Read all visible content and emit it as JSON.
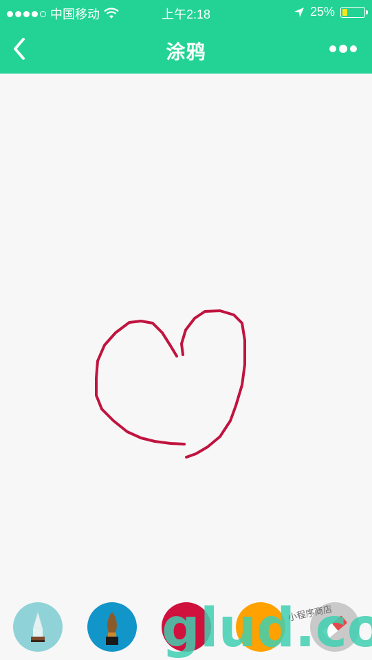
{
  "status_bar": {
    "carrier": "中国移动",
    "time": "上午2:18",
    "battery": "25%",
    "battery_level": 0.25
  },
  "nav": {
    "title": "涂鸦"
  },
  "toolbar": {
    "tools": [
      {
        "name": "pen",
        "color": "#8fd3d8"
      },
      {
        "name": "brush",
        "color": "#1295c9"
      },
      {
        "name": "color-red",
        "color": "#d0103d"
      },
      {
        "name": "color-orange",
        "color": "#ffa100"
      },
      {
        "name": "eraser",
        "color": "#c9c9c9"
      }
    ]
  },
  "drawing": {
    "stroke_color": "#c0143f"
  },
  "watermark": {
    "text": "glud.com",
    "small_text": "小程序商店"
  }
}
